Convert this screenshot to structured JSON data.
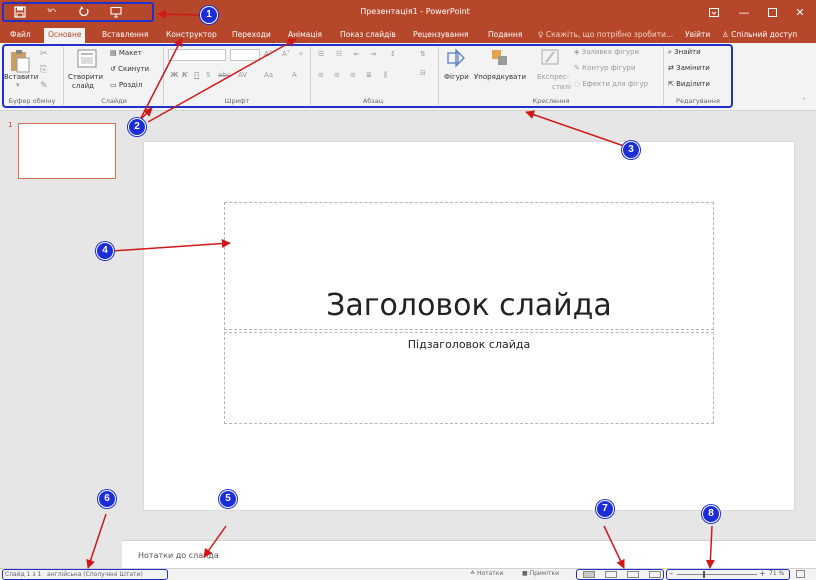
{
  "window": {
    "title": "Презентація1 - PowerPoint",
    "sign_in": "Увійти",
    "share": "Спільний доступ",
    "tell_me": "Скажіть, що потрібно зробити..."
  },
  "tabs": [
    {
      "label": "Файл"
    },
    {
      "label": "Основне",
      "active": true
    },
    {
      "label": "Вставлення"
    },
    {
      "label": "Конструктор"
    },
    {
      "label": "Переходи"
    },
    {
      "label": "Анімація"
    },
    {
      "label": "Показ слайдів"
    },
    {
      "label": "Рецензування"
    },
    {
      "label": "Подання"
    }
  ],
  "ribbon": {
    "clipboard": {
      "paste": "Вставити",
      "label": "Буфер обміну"
    },
    "slides": {
      "new_slide_1": "Створити",
      "new_slide_2": "слайд",
      "layout": "Макет",
      "reset": "Скинути",
      "section": "Розділ",
      "label": "Слайди"
    },
    "font": {
      "label": "Шрифт"
    },
    "paragraph": {
      "label": "Абзац"
    },
    "drawing": {
      "shapes": "Фігури",
      "arrange": "Упорядкувати",
      "quick_styles_1": "Експрес-",
      "quick_styles_2": "стилі",
      "shape_fill": "Заливка фігури",
      "shape_outline": "Контур фігури",
      "shape_effects": "Ефекти для фігур",
      "label": "Креслення"
    },
    "editing": {
      "find": "Знайти",
      "replace": "Замінити",
      "select": "Виділити",
      "label": "Редагування"
    }
  },
  "thumbnails": [
    {
      "number": "1"
    }
  ],
  "slide": {
    "title": "Заголовок слайда",
    "subtitle": "Підзаголовок слайда"
  },
  "notes": {
    "placeholder": "Нотатки до слайда"
  },
  "status": {
    "slide_info": "Слайд 1 з 1",
    "language": "англійська (Сполучені Штати)",
    "notes": "Нотатки",
    "comments": "Примітки",
    "zoom": "71 %",
    "zoom_level_percent": 71
  },
  "annotations": [
    "1",
    "2",
    "3",
    "4",
    "5",
    "6",
    "7",
    "8"
  ],
  "colors": {
    "accent": "#b7472a",
    "annotation": "#1a2dd6",
    "annotation_arrow": "#d01818"
  }
}
